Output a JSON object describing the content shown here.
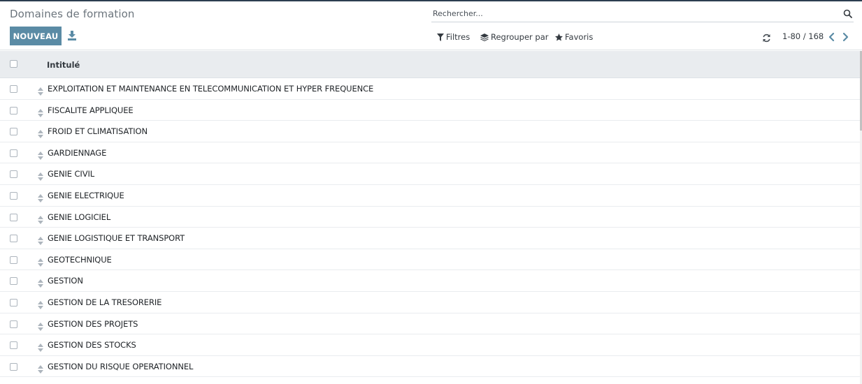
{
  "page": {
    "title": "Domaines de formation"
  },
  "toolbar": {
    "new_label": "NOUVEAU",
    "download_icon": "download-icon"
  },
  "search": {
    "placeholder": "Rechercher...",
    "value": "",
    "icon": "search-icon"
  },
  "filters": {
    "filters_label": "Filtres",
    "groupby_label": "Regrouper par",
    "favorites_label": "Favoris"
  },
  "pager": {
    "value": "1-80 / 168"
  },
  "list": {
    "column_header": "Intitulé",
    "rows": [
      "EXPLOITATION ET MAINTENANCE EN TELECOMMUNICATION ET HYPER FREQUENCE",
      "FISCALITE APPLIQUEE",
      "FROID ET CLIMATISATION",
      "GARDIENNAGE",
      "GENIE CIVIL",
      "GENIE ELECTRIQUE",
      "GENIE LOGICIEL",
      "GENIE LOGISTIQUE ET TRANSPORT",
      "GEOTECHNIQUE",
      "GESTION",
      "GESTION DE LA TRESORERIE",
      "GESTION DES PROJETS",
      "GESTION DES STOCKS",
      "GESTION DU RISQUE OPERATIONNEL",
      ""
    ]
  },
  "colors": {
    "primary": "#5a8ba5",
    "header_bg": "#e9ecef",
    "top_border": "#2c3e50"
  }
}
